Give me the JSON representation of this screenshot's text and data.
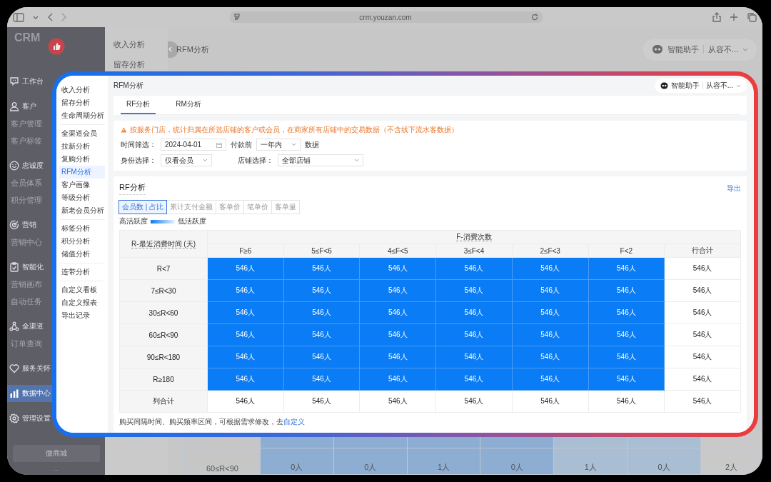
{
  "browser": {
    "url": "crm.youzan.com"
  },
  "nav": {
    "logo": "CRM",
    "sections": [
      {
        "label": "工作台",
        "selected": false
      },
      {
        "label": "客户",
        "selected": false,
        "children": [
          {
            "label": "客户管理",
            "selected": false
          },
          {
            "label": "客户标签",
            "selected": false
          }
        ]
      },
      {
        "label": "忠诚度",
        "selected": false,
        "children": [
          {
            "label": "会员体系",
            "selected": false
          },
          {
            "label": "积分管理",
            "selected": false
          }
        ]
      },
      {
        "label": "营销",
        "selected": false,
        "children": [
          {
            "label": "营销中心",
            "selected": false
          }
        ]
      },
      {
        "label": "智能化",
        "selected": false,
        "children": [
          {
            "label": "营销画布",
            "selected": false
          },
          {
            "label": "自动任务",
            "selected": false
          }
        ]
      },
      {
        "label": "全渠道",
        "selected": false,
        "children": [
          {
            "label": "订单查询",
            "selected": false
          }
        ]
      },
      {
        "label": "服务关怀",
        "selected": false
      },
      {
        "label": "数据中心",
        "selected": true
      },
      {
        "label": "管理设置",
        "selected": false
      }
    ],
    "store_button": "微商城",
    "more": "..."
  },
  "subnav": [
    "收入分析",
    "留存分析"
  ],
  "header": {
    "title": "RFM分析",
    "assistant": "智能助手",
    "account": "从容不..."
  },
  "background_table": {
    "row_label": "60≤R<90",
    "cells": [
      "0人",
      "0人",
      "1人",
      "0人",
      "1人",
      "0人",
      "2人"
    ]
  },
  "panel": {
    "sidebar": [
      {
        "items": [
          {
            "label": "收入分析",
            "selected": false
          },
          {
            "label": "留存分析",
            "selected": false
          },
          {
            "label": "生命周期分析",
            "selected": false
          }
        ]
      },
      {
        "items": [
          {
            "label": "全渠道会员",
            "selected": false
          },
          {
            "label": "拉新分析",
            "selected": false
          },
          {
            "label": "复购分析",
            "selected": false
          },
          {
            "label": "RFM分析",
            "selected": true
          },
          {
            "label": "客户画像",
            "selected": false
          },
          {
            "label": "等级分析",
            "selected": false
          },
          {
            "label": "新老会员分析",
            "selected": false
          }
        ]
      },
      {
        "items": [
          {
            "label": "标签分析",
            "selected": false
          },
          {
            "label": "积分分析",
            "selected": false
          },
          {
            "label": "储值分析",
            "selected": false
          }
        ]
      },
      {
        "items": [
          {
            "label": "连带分析",
            "selected": false
          }
        ]
      },
      {
        "items": [
          {
            "label": "自定义看板",
            "selected": false
          },
          {
            "label": "自定义报表",
            "selected": false
          },
          {
            "label": "导出记录",
            "selected": false
          }
        ]
      }
    ],
    "header": {
      "title": "RFM分析",
      "assistant": "智能助手",
      "account": "从容不..."
    },
    "tabs": [
      {
        "label": "RF分析",
        "selected": true
      },
      {
        "label": "RM分析",
        "selected": false
      }
    ],
    "notice": "按服务门店，统计归属在所选店铺的客户或会员，在商家所有店铺中的交易数据（不含线下流水客数据）",
    "filters": {
      "time_label": "时间筛选：",
      "date": "2024-04-01",
      "before_label": "付款前",
      "period": "一年内",
      "suffix": "数据",
      "identity_label": "身份选择：",
      "identity": "仅看会员",
      "store_label": "店铺选择：",
      "store": "全部店铺"
    },
    "report": {
      "title": "RF分析",
      "export": "导出",
      "metrics": [
        {
          "label": "会员数 | 占比",
          "selected": true
        },
        {
          "label": "累计支付金额",
          "selected": false
        },
        {
          "label": "客单价",
          "selected": false
        },
        {
          "label": "笔单价",
          "selected": false
        },
        {
          "label": "客单量",
          "selected": false
        }
      ],
      "legend": {
        "high": "高活跃度",
        "low": "低活跃度"
      },
      "table": {
        "row_header": "R-最近消费时间 (天)",
        "column_group": "F-消费次数",
        "columns": [
          "F≥6",
          "5≤F<6",
          "4≤F<5",
          "3≤F<4",
          "2≤F<3",
          "F<2",
          "行合计"
        ],
        "rows": [
          {
            "label": "R<7",
            "kind": "data",
            "cells": [
              "546人",
              "546人",
              "546人",
              "546人",
              "546人",
              "546人"
            ],
            "total": "546人"
          },
          {
            "label": "7≤R<30",
            "kind": "data",
            "cells": [
              "546人",
              "546人",
              "546人",
              "546人",
              "546人",
              "546人"
            ],
            "total": "546人"
          },
          {
            "label": "30≤R<60",
            "kind": "data",
            "cells": [
              "546人",
              "546人",
              "546人",
              "546人",
              "546人",
              "546人"
            ],
            "total": "546人"
          },
          {
            "label": "60≤R<90",
            "kind": "data",
            "cells": [
              "546人",
              "546人",
              "546人",
              "546人",
              "546人",
              "546人"
            ],
            "total": "546人"
          },
          {
            "label": "90≤R<180",
            "kind": "data",
            "cells": [
              "546人",
              "546人",
              "546人",
              "546人",
              "546人",
              "546人"
            ],
            "total": "546人"
          },
          {
            "label": "R≥180",
            "kind": "data",
            "cells": [
              "546人",
              "546人",
              "546人",
              "546人",
              "546人",
              "546人"
            ],
            "total": "546人"
          },
          {
            "label": "列合计",
            "kind": "total",
            "cells": [
              "546人",
              "546人",
              "546人",
              "546人",
              "546人",
              "546人"
            ],
            "total": "546人"
          }
        ]
      },
      "note": "购买间隔时间、购买频率区间，可根据需求修改，去",
      "note_link": "自定义"
    }
  }
}
